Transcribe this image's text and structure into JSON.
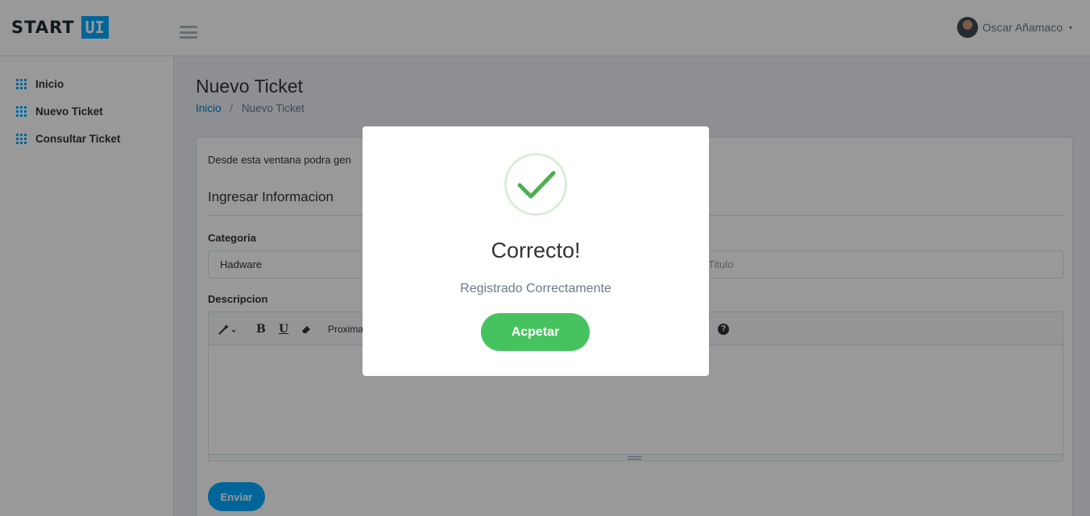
{
  "header": {
    "logo_text": "START",
    "logo_badge": "UI",
    "user_name": "Oscar Añamaco",
    "caret": "▾"
  },
  "sidebar": {
    "items": [
      {
        "label": "Inicio",
        "icon": "grid-icon"
      },
      {
        "label": "Nuevo Ticket",
        "icon": "grid-icon"
      },
      {
        "label": "Consultar Ticket",
        "icon": "grid-icon"
      }
    ]
  },
  "page": {
    "title": "Nuevo Ticket",
    "breadcrumb": {
      "home": "Inicio",
      "separator": "/",
      "current": "Nuevo Ticket"
    }
  },
  "form": {
    "intro": "Desde esta ventana podra gen",
    "section_title": "Ingresar Informacion",
    "categoria_label": "Categoria",
    "categoria_value": "Hadware",
    "titulo_placeholder": "Titulo",
    "descripcion_label": "Descripcion",
    "toolbar": {
      "style": "style-magic-icon",
      "bold": "B",
      "underline": "U",
      "eraser": "eraser-icon",
      "font_text": "Proxima",
      "help": "?"
    },
    "submit_label": "Enviar"
  },
  "modal": {
    "icon": "success-check-icon",
    "title": "Correcto!",
    "text": "Registrado Correctamente",
    "button_label": "Acpetar",
    "colors": {
      "success": "#46c35f",
      "check": "#4caf50"
    }
  },
  "colors": {
    "accent": "#00a8ff",
    "overlay": "rgba(0,0,0,0.4)"
  }
}
